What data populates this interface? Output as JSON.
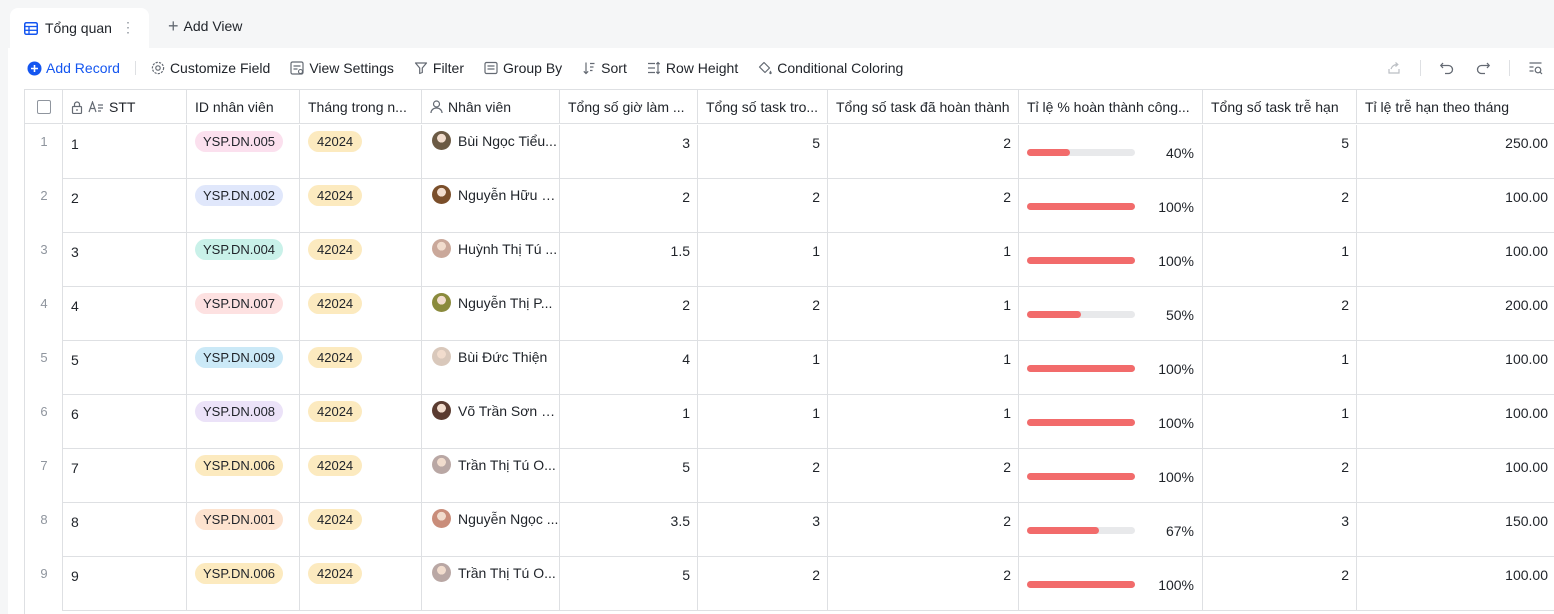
{
  "tabs": {
    "active_label": "Tổng quan",
    "add_view_label": "Add View"
  },
  "toolbar": {
    "add_record": "Add Record",
    "customize_field": "Customize Field",
    "view_settings": "View Settings",
    "filter": "Filter",
    "group_by": "Group By",
    "sort": "Sort",
    "row_height": "Row Height",
    "conditional_coloring": "Conditional Coloring"
  },
  "columns": {
    "stt": "STT",
    "id": "ID nhân viên",
    "month": "Tháng trong n...",
    "employee": "Nhân viên",
    "hours": "Tổng số giờ làm ...",
    "tasks_in": "Tổng số task tro...",
    "tasks_done": "Tổng số task đã hoàn thành",
    "done_rate": "Tỉ lệ % hoàn thành công...",
    "tasks_late": "Tổng số task trễ hạn",
    "late_rate": "Tỉ lệ trễ hạn theo tháng"
  },
  "rows": [
    {
      "num": "1",
      "stt": "1",
      "id": "YSP.DN.005",
      "id_color": "#fbe0ee",
      "month": "42024",
      "name": "Bùi Ngọc Tiểu...",
      "avatar": "#6b5a44",
      "hours": "3",
      "tasks_in": "5",
      "tasks_done": "2",
      "rate": 0.4,
      "rate_label": "40%",
      "late": "5",
      "late_rate": "250.00"
    },
    {
      "num": "2",
      "stt": "2",
      "id": "YSP.DN.002",
      "id_color": "#e0e7fb",
      "month": "42024",
      "name": "Nguyễn Hữu Hải",
      "avatar": "#7a4e2a",
      "hours": "2",
      "tasks_in": "2",
      "tasks_done": "2",
      "rate": 1.0,
      "rate_label": "100%",
      "late": "2",
      "late_rate": "100.00"
    },
    {
      "num": "3",
      "stt": "3",
      "id": "YSP.DN.004",
      "id_color": "#c9f1e9",
      "month": "42024",
      "name": "Huỳnh Thị Tú ...",
      "avatar": "#caa89a",
      "hours": "1.5",
      "tasks_in": "1",
      "tasks_done": "1",
      "rate": 1.0,
      "rate_label": "100%",
      "late": "1",
      "late_rate": "100.00"
    },
    {
      "num": "4",
      "stt": "4",
      "id": "YSP.DN.007",
      "id_color": "#fde1e1",
      "month": "42024",
      "name": "Nguyễn Thị P...",
      "avatar": "#8a8a3c",
      "hours": "2",
      "tasks_in": "2",
      "tasks_done": "1",
      "rate": 0.5,
      "rate_label": "50%",
      "late": "2",
      "late_rate": "200.00"
    },
    {
      "num": "5",
      "stt": "5",
      "id": "YSP.DN.009",
      "id_color": "#cbe9f7",
      "month": "42024",
      "name": "Bùi Đức Thiện",
      "avatar": "#d9c8bb",
      "hours": "4",
      "tasks_in": "1",
      "tasks_done": "1",
      "rate": 1.0,
      "rate_label": "100%",
      "late": "1",
      "late_rate": "100.00"
    },
    {
      "num": "6",
      "stt": "6",
      "id": "YSP.DN.008",
      "id_color": "#ebe2f8",
      "month": "42024",
      "name": "Võ Trần Sơn P...",
      "avatar": "#5a3b30",
      "hours": "1",
      "tasks_in": "1",
      "tasks_done": "1",
      "rate": 1.0,
      "rate_label": "100%",
      "late": "1",
      "late_rate": "100.00"
    },
    {
      "num": "7",
      "stt": "7",
      "id": "YSP.DN.006",
      "id_color": "#fceabf",
      "month": "42024",
      "name": "Trần Thị Tú O...",
      "avatar": "#b9a7a4",
      "hours": "5",
      "tasks_in": "2",
      "tasks_done": "2",
      "rate": 1.0,
      "rate_label": "100%",
      "late": "2",
      "late_rate": "100.00"
    },
    {
      "num": "8",
      "stt": "8",
      "id": "YSP.DN.001",
      "id_color": "#fde3cf",
      "month": "42024",
      "name": "Nguyễn Ngọc ...",
      "avatar": "#c98d7a",
      "hours": "3.5",
      "tasks_in": "3",
      "tasks_done": "2",
      "rate": 0.67,
      "rate_label": "67%",
      "late": "3",
      "late_rate": "150.00"
    },
    {
      "num": "9",
      "stt": "9",
      "id": "YSP.DN.006",
      "id_color": "#fceabf",
      "month": "42024",
      "name": "Trần Thị Tú O...",
      "avatar": "#b9a7a4",
      "hours": "5",
      "tasks_in": "2",
      "tasks_done": "2",
      "rate": 1.0,
      "rate_label": "100%",
      "late": "2",
      "late_rate": "100.00"
    }
  ],
  "colors": {
    "accent": "#1456f0",
    "progress": "#f26b6b",
    "progress_track": "#e8e9eb",
    "month_tag": "#fceabf"
  }
}
